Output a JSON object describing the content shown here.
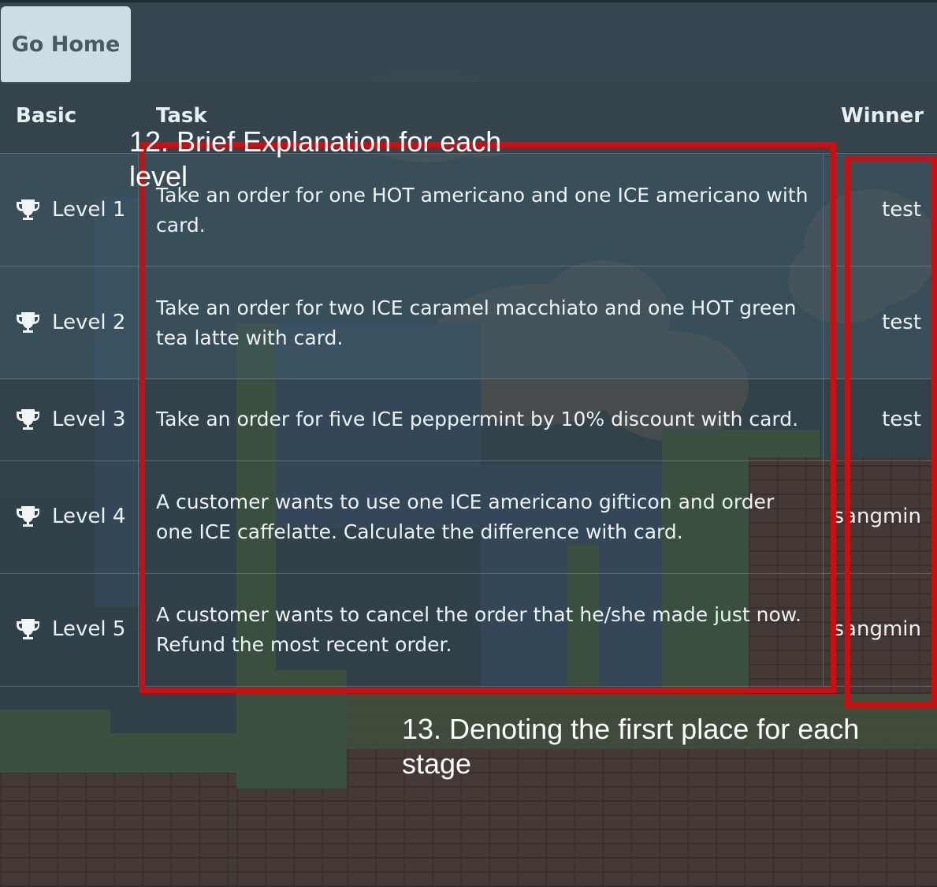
{
  "home_button": {
    "label": "Go Home"
  },
  "table": {
    "headers": {
      "basic": "Basic",
      "task": "Task",
      "winner": "Winner"
    },
    "rows": [
      {
        "level": "Level 1",
        "task": "Take an order for one HOT americano and one ICE americano with card.",
        "winner": "test"
      },
      {
        "level": "Level 2",
        "task": "Take an order for two ICE caramel macchiato and one HOT green tea latte with card.",
        "winner": "test"
      },
      {
        "level": "Level 3",
        "task": "Take an order for five ICE peppermint by 10% discount with card.",
        "winner": "test"
      },
      {
        "level": "Level 4",
        "task": "A customer wants to use one ICE americano gifticon and order one ICE caffelatte. Calculate the difference with card.",
        "winner": "sangmin"
      },
      {
        "level": "Level 5",
        "task": "A customer wants to cancel the order that he/she made just now. Refund the most recent order.",
        "winner": "sangmin"
      }
    ]
  },
  "annotations": {
    "note_12": "12. Brief Explanation for each level",
    "note_13": "13. Denoting the firsrt place for each stage"
  },
  "colors": {
    "annotation_red": "#c90f12",
    "home_button_bg": "#cddde5"
  },
  "icons": {
    "level": "trophy-icon"
  }
}
